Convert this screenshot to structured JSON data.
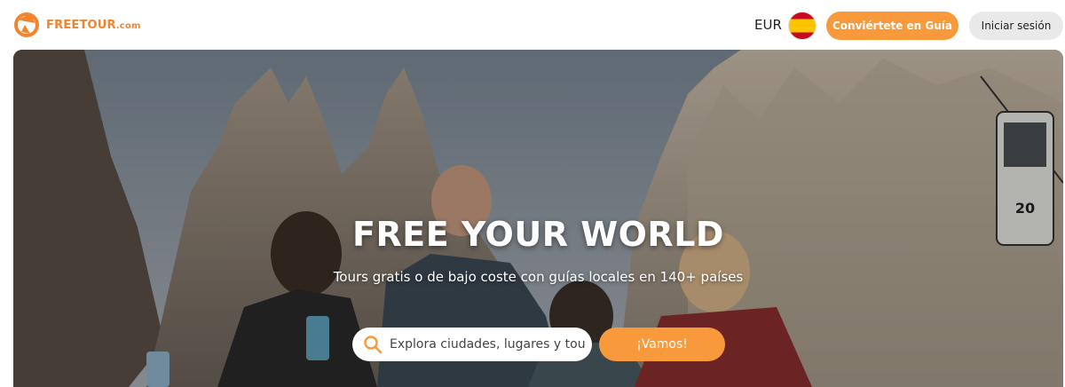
{
  "header": {
    "logo": {
      "brand": "FREETOUR",
      "suffix": ".com"
    },
    "currency": "EUR",
    "language_flag": "spain-flag-icon",
    "become_guide_label": "Conviértete en Guía",
    "login_label": "Iniciar sesión"
  },
  "hero": {
    "title": "FREE YOUR WORLD",
    "subtitle": "Tours gratis o de bajo coste con guías locales en 140+ países",
    "search": {
      "placeholder": "Explora ciudades, lugares y tours",
      "icon": "search-icon"
    },
    "go_label": "¡Vamos!",
    "cable_car_number": "20"
  },
  "colors": {
    "accent": "#f89a3b",
    "logo": "#f2842e",
    "login_bg": "#e9e9e9"
  }
}
